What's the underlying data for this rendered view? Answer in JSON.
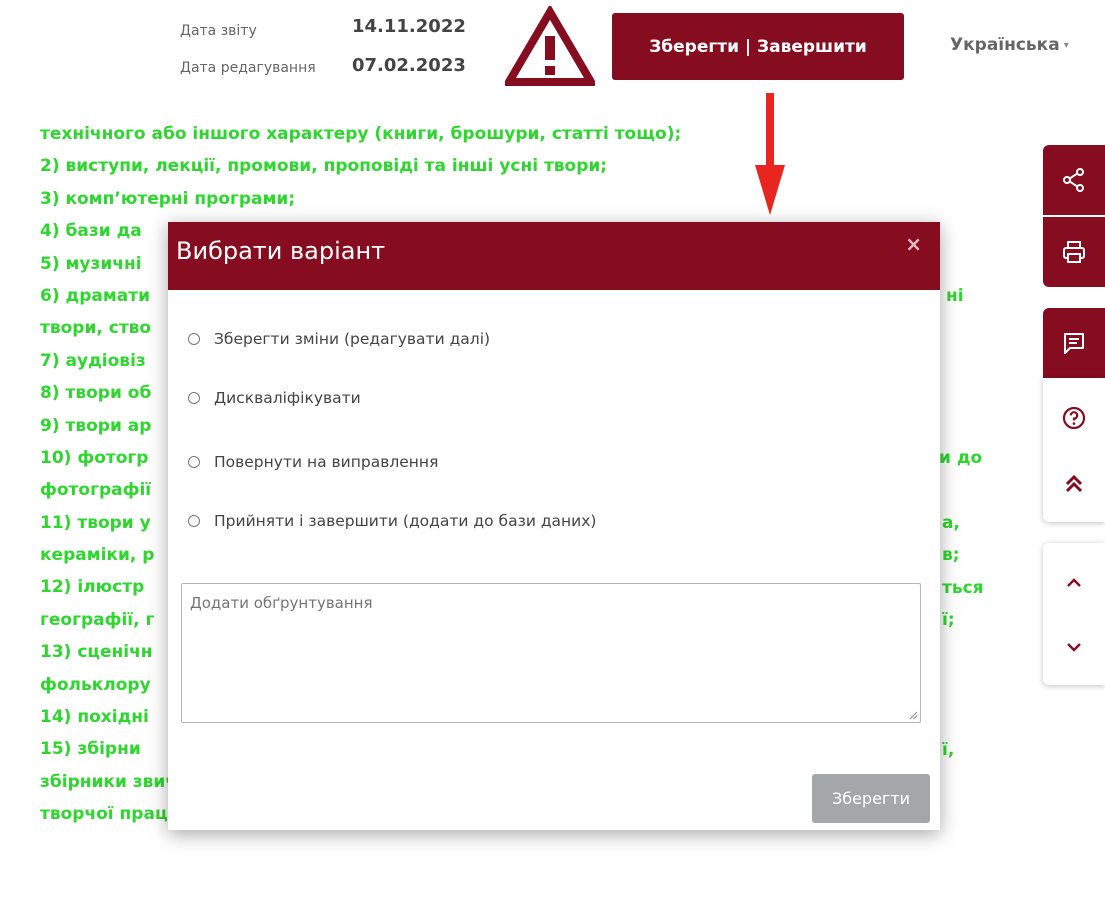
{
  "header": {
    "report_date_label": "Дата звіту",
    "report_date_value": "14.11.2022",
    "edit_date_label": "Дата редагування",
    "edit_date_value": "07.02.2023",
    "save_finish_label": "Зберегти | Завершити",
    "language": "Українська",
    "language_caret": "▾"
  },
  "content": {
    "lines": [
      "технічного або іншого характеру (книги, брошури, статті тощо);",
      "2) виступи, лекції, промови, проповіді та інші усні твори;",
      "3) комп’ютерні програми;",
      "4) бази да",
      "5) музичні",
      "6) драмати",
      "твори, ство",
      "7) аудіовіз",
      "8) твори об",
      "9) твори ар",
      "10) фотогр",
      "фотографії",
      "11) твори у",
      "кераміки, р",
      "12) ілюстр",
      "географії, г",
      "13) сценічн",
      "фольклору",
      "14) похідні",
      "15) збірни",
      "збірники звичайних даних, інші складені твори за умови, що вони є результатом",
      "творчої праці за добором, координацією або упорядкуванням змісту без"
    ],
    "right_fragments": [
      {
        "line": 5,
        "text": "ні"
      },
      {
        "line": 10,
        "text": "и до"
      },
      {
        "line": 12,
        "text": "а,"
      },
      {
        "line": 13,
        "text": "в;"
      },
      {
        "line": 14,
        "text": "ться"
      },
      {
        "line": 15,
        "text": "ї;"
      },
      {
        "line": 19,
        "text": "ї,"
      }
    ]
  },
  "modal": {
    "title": "Вибрати варіант",
    "close": "×",
    "options": [
      "Зберегти зміни (редагувати далі)",
      "Дискваліфікувати",
      "Повернути на виправлення",
      "Прийняти і завершити (додати до бази даних)"
    ],
    "reason_placeholder": "Додати обґрунтування",
    "save_label": "Зберегти"
  },
  "sidebar": {
    "icons": [
      "share-icon",
      "print-icon",
      "comment-icon",
      "help-icon",
      "double-chevron-up-icon",
      "chevron-up-icon",
      "chevron-down-icon"
    ]
  },
  "colors": {
    "brand": "#860d1f",
    "content_text": "#2fd62f",
    "disabled_button": "#a3a7aa",
    "arrow": "#e8251e"
  }
}
